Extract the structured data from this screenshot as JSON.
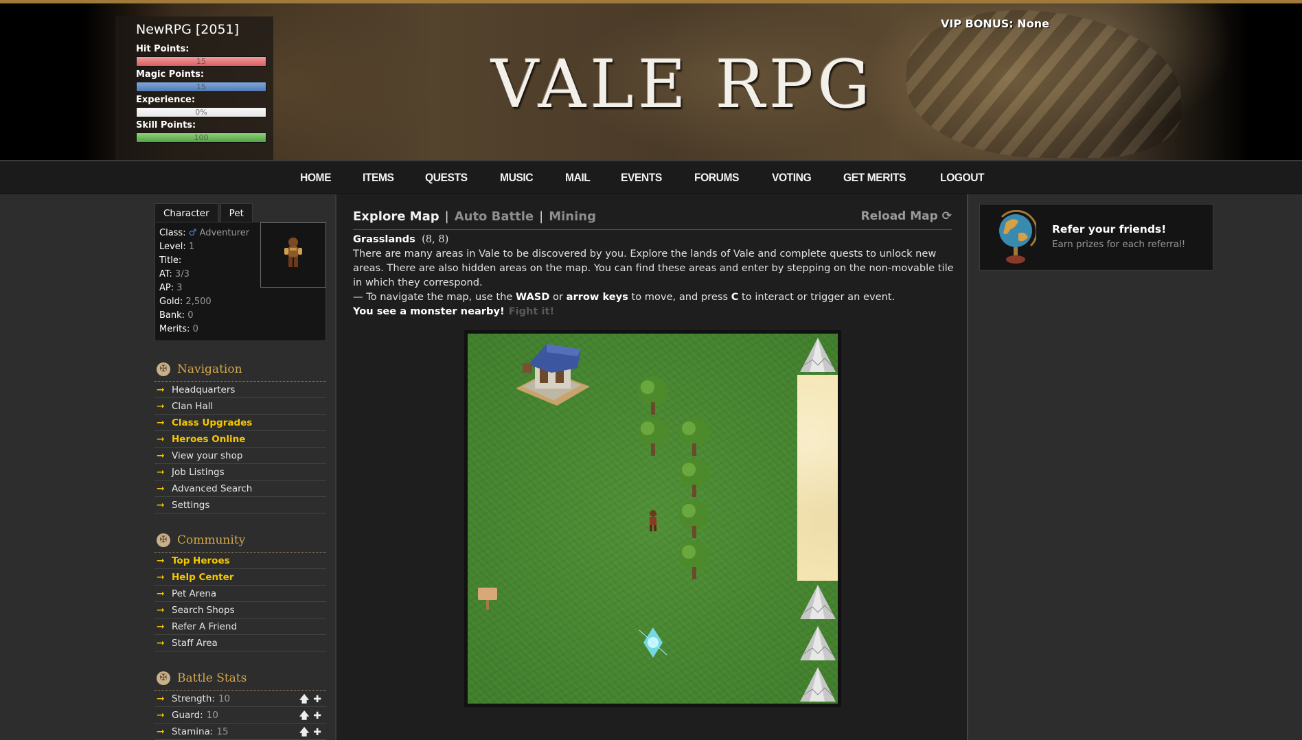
{
  "header": {
    "logo": "VALE RPG",
    "vip_bonus": "VIP BONUS: None",
    "player": {
      "name": "NewRPG [2051]",
      "stats": [
        {
          "label": "Hit Points:",
          "value": "15",
          "fill_percent": 100,
          "key": "hp"
        },
        {
          "label": "Magic Points:",
          "value": "15",
          "fill_percent": 100,
          "key": "mp"
        },
        {
          "label": "Experience:",
          "value": "0%",
          "fill_percent": 0,
          "key": "xp"
        },
        {
          "label": "Skill Points:",
          "value": "100",
          "fill_percent": 100,
          "key": "sp"
        }
      ]
    }
  },
  "topnav": [
    "HOME",
    "ITEMS",
    "QUESTS",
    "MUSIC",
    "MAIL",
    "EVENTS",
    "FORUMS",
    "VOTING",
    "GET MERITS",
    "LOGOUT"
  ],
  "character": {
    "tabs": [
      "Character",
      "Pet"
    ],
    "fields": [
      {
        "k": "Class:",
        "v": "Adventurer",
        "icon": "male-icon"
      },
      {
        "k": "Level:",
        "v": "1"
      },
      {
        "k": "Title:",
        "v": ""
      },
      {
        "k": "AT:",
        "v": "3/3"
      },
      {
        "k": "AP:",
        "v": "3"
      },
      {
        "k": "Gold:",
        "v": "2,500"
      },
      {
        "k": "Bank:",
        "v": "0"
      },
      {
        "k": "Merits:",
        "v": "0"
      }
    ]
  },
  "sidebar": {
    "navigation": {
      "title": "Navigation",
      "items": [
        {
          "label": "Headquarters",
          "highlight": false
        },
        {
          "label": "Clan Hall",
          "highlight": false
        },
        {
          "label": "Class Upgrades",
          "highlight": true
        },
        {
          "label": "Heroes Online",
          "highlight": true
        },
        {
          "label": "View your shop",
          "highlight": false
        },
        {
          "label": "Job Listings",
          "highlight": false
        },
        {
          "label": "Advanced Search",
          "highlight": false
        },
        {
          "label": "Settings",
          "highlight": false
        }
      ]
    },
    "community": {
      "title": "Community",
      "items": [
        {
          "label": "Top Heroes",
          "highlight": true
        },
        {
          "label": "Help Center",
          "highlight": true
        },
        {
          "label": "Pet Arena",
          "highlight": false
        },
        {
          "label": "Search Shops",
          "highlight": false
        },
        {
          "label": "Refer A Friend",
          "highlight": false
        },
        {
          "label": "Staff Area",
          "highlight": false
        }
      ]
    },
    "battle_stats": {
      "title": "Battle Stats",
      "items": [
        {
          "label": "Strength:",
          "value": "10"
        },
        {
          "label": "Guard:",
          "value": "10"
        },
        {
          "label": "Stamina:",
          "value": "15"
        }
      ]
    }
  },
  "main": {
    "tabs": {
      "active": "Explore Map",
      "others": [
        "Auto Battle",
        "Mining"
      ],
      "separator": "|"
    },
    "reload_label": "Reload Map",
    "area_name": "Grasslands",
    "coords": "(8, 8)",
    "description": "There are many areas in Vale to be discovered by you. Explore the lands of Vale and complete quests to unlock new areas. There are also hidden areas on the map. You can find these areas and enter by stepping on the non-movable tile in which they correspond.",
    "help": {
      "prefix": "— To navigate the map, use the ",
      "key1": "WASD",
      "mid1": " or ",
      "key2": "arrow keys",
      "mid2": " to move, and press ",
      "key3": "C",
      "suffix": " to interact or trigger an event."
    },
    "monster_notice": "You see a monster nearby!",
    "fight_label": "Fight it!"
  },
  "referral": {
    "title": "Refer your friends!",
    "subtitle": "Earn prizes for each referral!"
  },
  "colors": {
    "accent_gold": "#d4a84a",
    "highlight_yellow": "#f5c800",
    "hp": "#d95f63",
    "mp": "#4f7ab4",
    "sp": "#52a342"
  }
}
